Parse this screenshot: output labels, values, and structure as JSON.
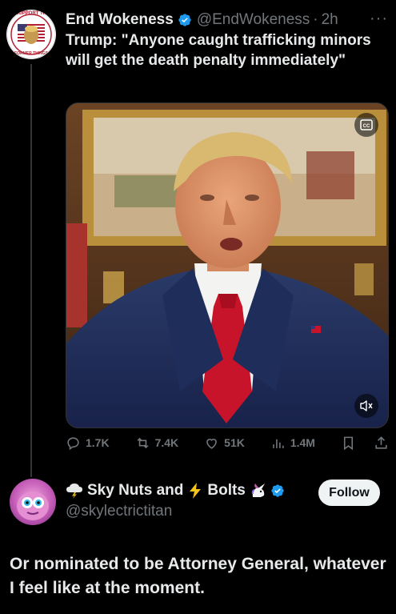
{
  "tweet": {
    "author_name": "End Wokeness",
    "handle": "@EndWokeness",
    "separator": "·",
    "time": "2h",
    "more": "···",
    "avatar_text_top": "I SUPPORT THE",
    "avatar_text_bottom": "FORMER THINGS",
    "text": "Trump: \"Anyone caught trafficking minors will get the death penalty immediately\"",
    "media": {
      "cc_icon": "cc-icon",
      "mute_icon": "mute-icon"
    },
    "actions": {
      "replies": "1.7K",
      "reposts": "7.4K",
      "likes": "51K",
      "views": "1.4M"
    }
  },
  "reply": {
    "name_part1": "Sky Nuts and",
    "name_part2": "Bolts",
    "handle": "@skylectrictitan",
    "follow_label": "Follow",
    "text": "Or nominated to be Attorney General, whatever I feel like at the moment."
  },
  "colors": {
    "background": "#000000",
    "text_primary": "#e7e9ea",
    "text_secondary": "#71767b",
    "verified": "#1d9bf0",
    "follow_bg": "#eff3f4"
  }
}
